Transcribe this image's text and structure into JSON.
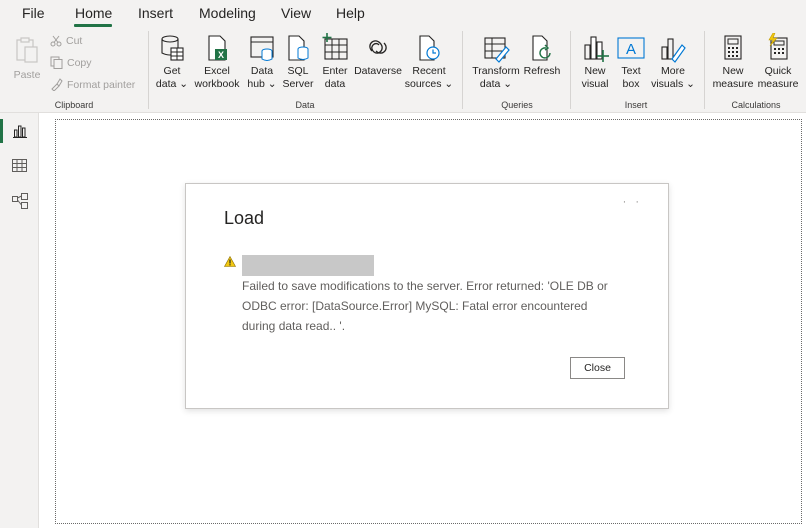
{
  "menu": {
    "items": [
      "File",
      "Home",
      "Insert",
      "Modeling",
      "View",
      "Help"
    ],
    "active": "Home"
  },
  "ribbon": {
    "clipboard": {
      "group_label": "Clipboard",
      "paste": "Paste",
      "cut": "Cut",
      "copy": "Copy",
      "format_painter": "Format painter"
    },
    "data": {
      "group_label": "Data",
      "get_data": [
        "Get",
        "data ⌄"
      ],
      "excel_workbook": [
        "Excel",
        "workbook"
      ],
      "data_hub": [
        "Data",
        "hub ⌄"
      ],
      "sql_server": [
        "SQL",
        "Server"
      ],
      "enter_data": [
        "Enter",
        "data"
      ],
      "dataverse": [
        "Dataverse",
        ""
      ],
      "recent_sources": [
        "Recent",
        "sources ⌄"
      ]
    },
    "queries": {
      "group_label": "Queries",
      "transform_data": [
        "Transform",
        "data ⌄"
      ],
      "refresh": [
        "Refresh",
        ""
      ]
    },
    "insert": {
      "group_label": "Insert",
      "new_visual": [
        "New",
        "visual"
      ],
      "text_box": [
        "Text",
        "box"
      ],
      "more_visuals": [
        "More",
        "visuals ⌄"
      ]
    },
    "calculations": {
      "group_label": "Calculations",
      "new_measure": [
        "New",
        "measure"
      ],
      "quick_measure": [
        "Quick",
        "measure"
      ]
    }
  },
  "rail": {
    "items": [
      "report-view",
      "table-view",
      "model-view"
    ],
    "active": "report-view"
  },
  "dialog": {
    "title": "Load",
    "dots": "· ·",
    "error_message": "Failed to save modifications to the server. Error returned: 'OLE DB or ODBC error: [DataSource.Error] MySQL: Fatal error encountered during data read.. '.",
    "close_label": "Close"
  },
  "colors": {
    "accent": "#217346",
    "warning": "#c19c00",
    "excel_green": "#217346"
  }
}
